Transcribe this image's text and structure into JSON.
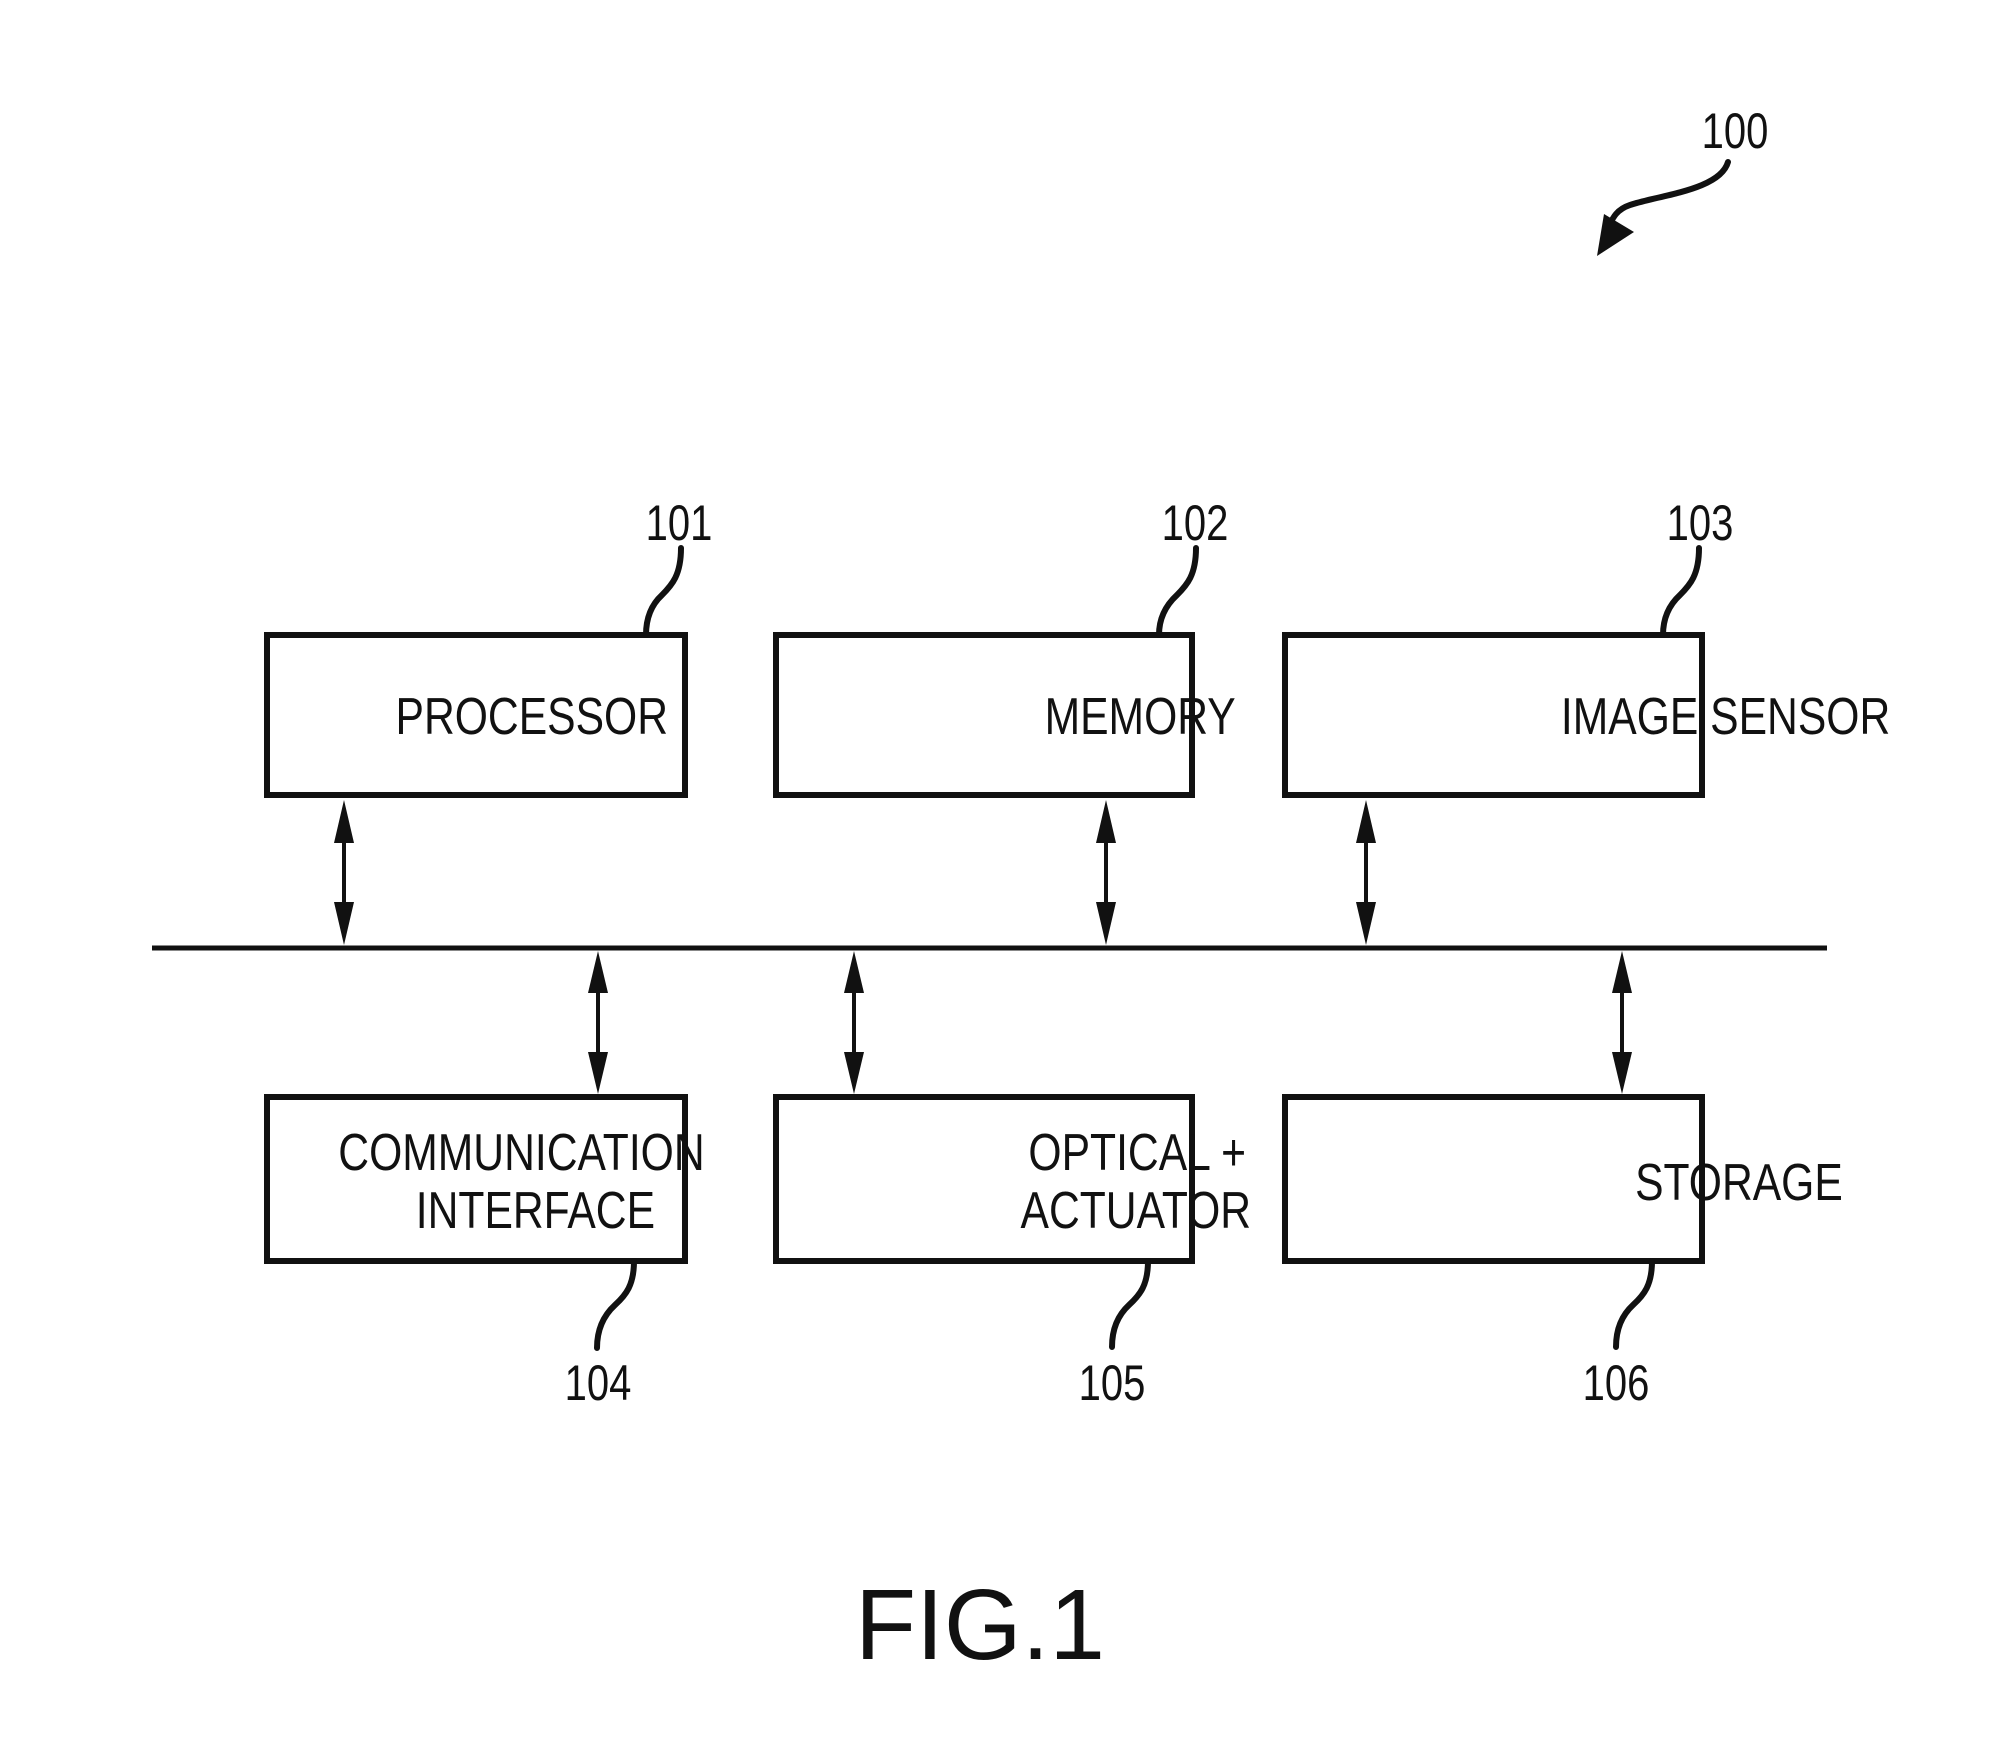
{
  "figure": {
    "title": "FIG.1",
    "system_ref": "100"
  },
  "blocks": [
    {
      "id": "processor",
      "ref": "101",
      "lines": [
        "PROCESSOR"
      ]
    },
    {
      "id": "memory",
      "ref": "102",
      "lines": [
        "MEMORY"
      ]
    },
    {
      "id": "image-sensor",
      "ref": "103",
      "lines": [
        "IMAGE SENSOR"
      ]
    },
    {
      "id": "communication-interface",
      "ref": "104",
      "lines": [
        "COMMUNICATION",
        "INTERFACE"
      ]
    },
    {
      "id": "optical-actuator",
      "ref": "105",
      "lines": [
        "OPTICAL +",
        "ACTUATOR"
      ]
    },
    {
      "id": "storage",
      "ref": "106",
      "lines": [
        "STORAGE"
      ]
    }
  ],
  "bus": {
    "connections": [
      "processor",
      "memory",
      "image-sensor",
      "communication-interface",
      "optical-actuator",
      "storage"
    ],
    "arrow_type": "bidirectional"
  }
}
